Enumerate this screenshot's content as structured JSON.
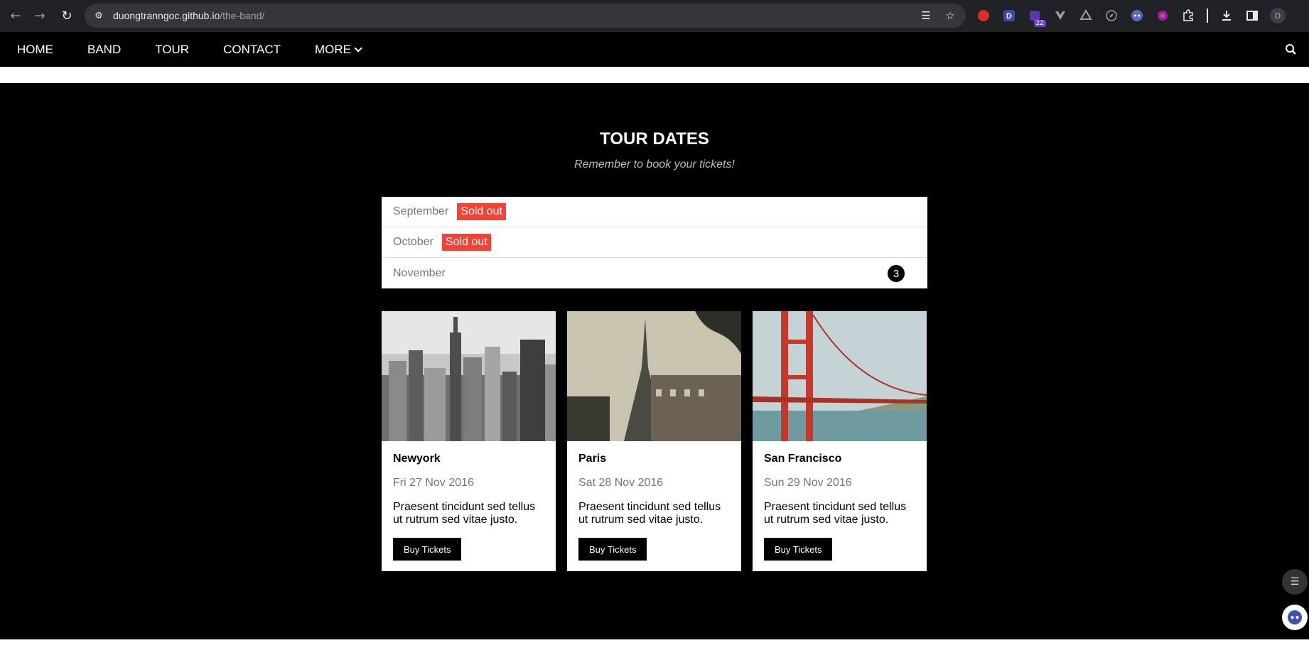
{
  "browser": {
    "url_host": "duongtranngoc.github.io",
    "url_path": "/the-band/",
    "extension_badge": "22",
    "profile_initial": "D",
    "icons": {
      "back": "arrow-left-icon",
      "forward": "arrow-right-icon",
      "reload": "reload-icon",
      "site_info": "tune-icon",
      "translate": "translate-icon",
      "bookmark": "star-icon",
      "downloads": "download-icon",
      "sidepanel": "side-panel-icon",
      "extensions": "puzzle-icon"
    }
  },
  "nav": {
    "items": [
      {
        "label": "HOME"
      },
      {
        "label": "BAND"
      },
      {
        "label": "TOUR"
      },
      {
        "label": "CONTACT"
      },
      {
        "label": "MORE"
      }
    ],
    "search_icon": "search-icon"
  },
  "tour": {
    "title": "TOUR DATES",
    "subtitle": "Remember to book your tickets!",
    "months": [
      {
        "name": "September",
        "status": "Sold out"
      },
      {
        "name": "October",
        "status": "Sold out"
      },
      {
        "name": "November",
        "count": "3"
      }
    ],
    "cards": [
      {
        "city": "Newyork",
        "date": "Fri 27 Nov 2016",
        "text": "Praesent tincidunt sed tellus ut rutrum sed vitae justo.",
        "button": "Buy Tickets"
      },
      {
        "city": "Paris",
        "date": "Sat 28 Nov 2016",
        "text": "Praesent tincidunt sed tellus ut rutrum sed vitae justo.",
        "button": "Buy Tickets"
      },
      {
        "city": "San Francisco",
        "date": "Sun 29 Nov 2016",
        "text": "Praesent tincidunt sed tellus ut rutrum sed vitae justo.",
        "button": "Buy Tickets"
      }
    ]
  },
  "colors": {
    "sold_out": "#f44336",
    "nav_bg": "#000000",
    "chrome_bg": "#202124"
  }
}
